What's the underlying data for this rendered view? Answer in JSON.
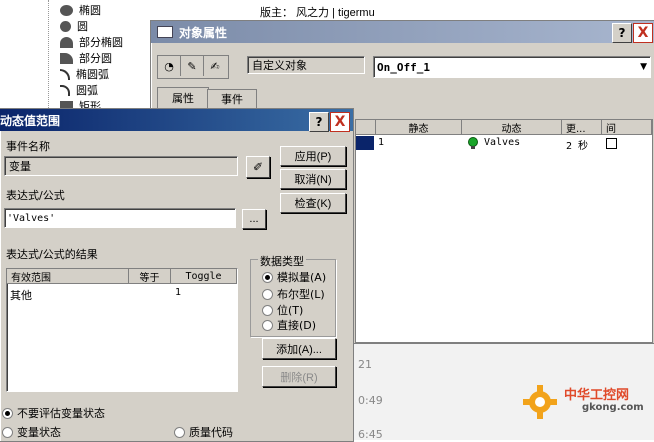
{
  "tree": {
    "items": [
      {
        "label": "椭圆",
        "icon": "ellipse-icon"
      },
      {
        "label": "圆",
        "icon": "circle-icon"
      },
      {
        "label": "部分椭圆",
        "icon": "partial-ellipse-icon"
      },
      {
        "label": "部分圆",
        "icon": "partial-circle-icon"
      },
      {
        "label": "椭圆弧",
        "icon": "ellipse-arc-icon"
      },
      {
        "label": "圆弧",
        "icon": "arc-icon"
      },
      {
        "label": "矩形",
        "icon": "rect-icon"
      }
    ]
  },
  "forum": {
    "moderator": "版主： 风之力 | tigermu"
  },
  "background": {
    "times": [
      "21",
      "0:49",
      "6:45"
    ]
  },
  "obj_props": {
    "title": "对象属性",
    "help": "?",
    "close": "X",
    "object_type_label": "自定义对象",
    "object_name": "On_Off_1",
    "tabs": [
      "属性",
      "事件"
    ],
    "list_headers": [
      "静态",
      "动态",
      "更...",
      "间"
    ],
    "row": {
      "static": "1",
      "dynamic": "Valves",
      "update": "2 秒"
    }
  },
  "dialog": {
    "title": "动态值范围",
    "help": "?",
    "close": "X",
    "event_name_label": "事件名称",
    "variable_value": "变量",
    "expression_label": "表达式/公式",
    "expression_value": "'Valves'",
    "browse_button": "...",
    "apply_button": "应用(P)",
    "cancel_button": "取消(N)",
    "check_button": "检查(K)",
    "result_label": "表达式/公式的结果",
    "result_headers": [
      "有效范围",
      "等于",
      "Toggle"
    ],
    "result_rows": [
      [
        "其他",
        "",
        "1"
      ]
    ],
    "datatype_label": "数据类型",
    "datatypes": [
      "模拟量(A)",
      "布尔型(L)",
      "位(T)",
      "直接(D)"
    ],
    "add_button": "添加(A)...",
    "delete_button": "删除(R)",
    "bottom_options": [
      "不要评估变量状态",
      "变量状态",
      "质量代码"
    ]
  },
  "watermark": {
    "name": "中华工控网",
    "url": "gkong.com"
  }
}
